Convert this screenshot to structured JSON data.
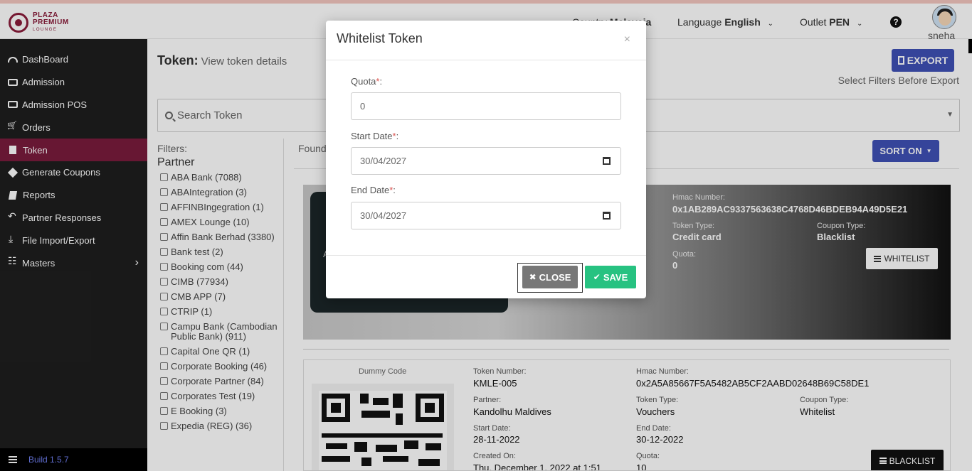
{
  "header": {
    "logo": {
      "line1": "PLAZA",
      "line2": "PREMIUM",
      "line3": "LOUNGE"
    },
    "country_label": "Country",
    "country_value": "Malaysia",
    "language_label": "Language",
    "language_value": "English",
    "outlet_label": "Outlet",
    "outlet_value": "PEN",
    "help_glyph": "?",
    "username": "sneha"
  },
  "sidebar": {
    "items": [
      {
        "label": "DashBoard",
        "icon": "dashboard-icon"
      },
      {
        "label": "Admission",
        "icon": "id-card-icon"
      },
      {
        "label": "Admission POS",
        "icon": "id-card-icon"
      },
      {
        "label": "Orders",
        "icon": "cart-icon"
      },
      {
        "label": "Token",
        "icon": "file-icon",
        "active": true
      },
      {
        "label": "Generate Coupons",
        "icon": "tag-icon"
      },
      {
        "label": "Reports",
        "icon": "book-icon"
      },
      {
        "label": "Partner Responses",
        "icon": "reply-icon"
      },
      {
        "label": "File Import/Export",
        "icon": "download-icon"
      },
      {
        "label": "Masters",
        "icon": "sitemap-icon"
      }
    ],
    "build": "Build 1.5.7"
  },
  "main": {
    "title": "Token:",
    "subtitle": "View token details",
    "export_label": "EXPORT",
    "export_hint": "Select Filters Before Export",
    "search_placeholder": "Search Token",
    "filters_label": "Filters:",
    "filters_group": "Partner",
    "filters": [
      "ABA Bank (7088)",
      "ABAIntegration (3)",
      "AFFINBIngegration (1)",
      "AMEX Lounge (10)",
      "Affin Bank Berhad (3380)",
      "Bank test (2)",
      "Booking com (44)",
      "CIMB (77934)",
      "CMB APP (7)",
      "CTRIP (1)",
      "Campu Bank (Cambodian Public Bank) (911)",
      "Capital One QR (1)",
      "Corporate Booking (46)",
      "Corporate Partner (84)",
      "Corporates Test (19)",
      "E Booking (3)",
      "Expedia (REG) (36)"
    ],
    "found_label": "Found",
    "sort_label": "SORT ON"
  },
  "card1": {
    "qr_side_text": "A",
    "hmac_label": "Hmac Number:",
    "hmac_value": "0x1AB289AC9337563638C4768D46BDEB94A49D5E21",
    "token_type_label": "Token Type:",
    "token_type_value": "Credit card",
    "coupon_type_label": "Coupon Type:",
    "coupon_type_value": "Blacklist",
    "quota_label": "Quota:",
    "quota_value": "0",
    "whitelist_label": "WHITELIST"
  },
  "card2": {
    "dummy_code": "Dummy Code",
    "token_number_label": "Token Number:",
    "token_number_value": "KMLE-005",
    "hmac_label": "Hmac Number:",
    "hmac_value": "0x2A5A85667F5A5482AB5CF2AABD02648B69C58DE1",
    "partner_label": "Partner:",
    "partner_value": "Kandolhu Maldives",
    "token_type_label": "Token Type:",
    "token_type_value": "Vouchers",
    "coupon_type_label": "Coupon Type:",
    "coupon_type_value": "Whitelist",
    "start_date_label": "Start Date:",
    "start_date_value": "28-11-2022",
    "end_date_label": "End Date:",
    "end_date_value": "30-12-2022",
    "created_label": "Created On:",
    "created_value": "Thu, December 1, 2022 at 1:51",
    "quota_label": "Quota:",
    "quota_value": "10",
    "blacklist_label": "BLACKLIST"
  },
  "modal": {
    "title": "Whitelist Token",
    "close_x": "×",
    "quota_label": "Quota",
    "quota_value": "0",
    "start_label": "Start Date",
    "start_value": "30/04/2027",
    "end_label": "End Date",
    "end_value": "30/04/2027",
    "required_mark": "*",
    "colon": ":",
    "close_label": "CLOSE",
    "save_label": "SAVE"
  },
  "colors": {
    "accent": "#7a1c3c",
    "primary": "#3f51b5",
    "success": "#27c281"
  }
}
